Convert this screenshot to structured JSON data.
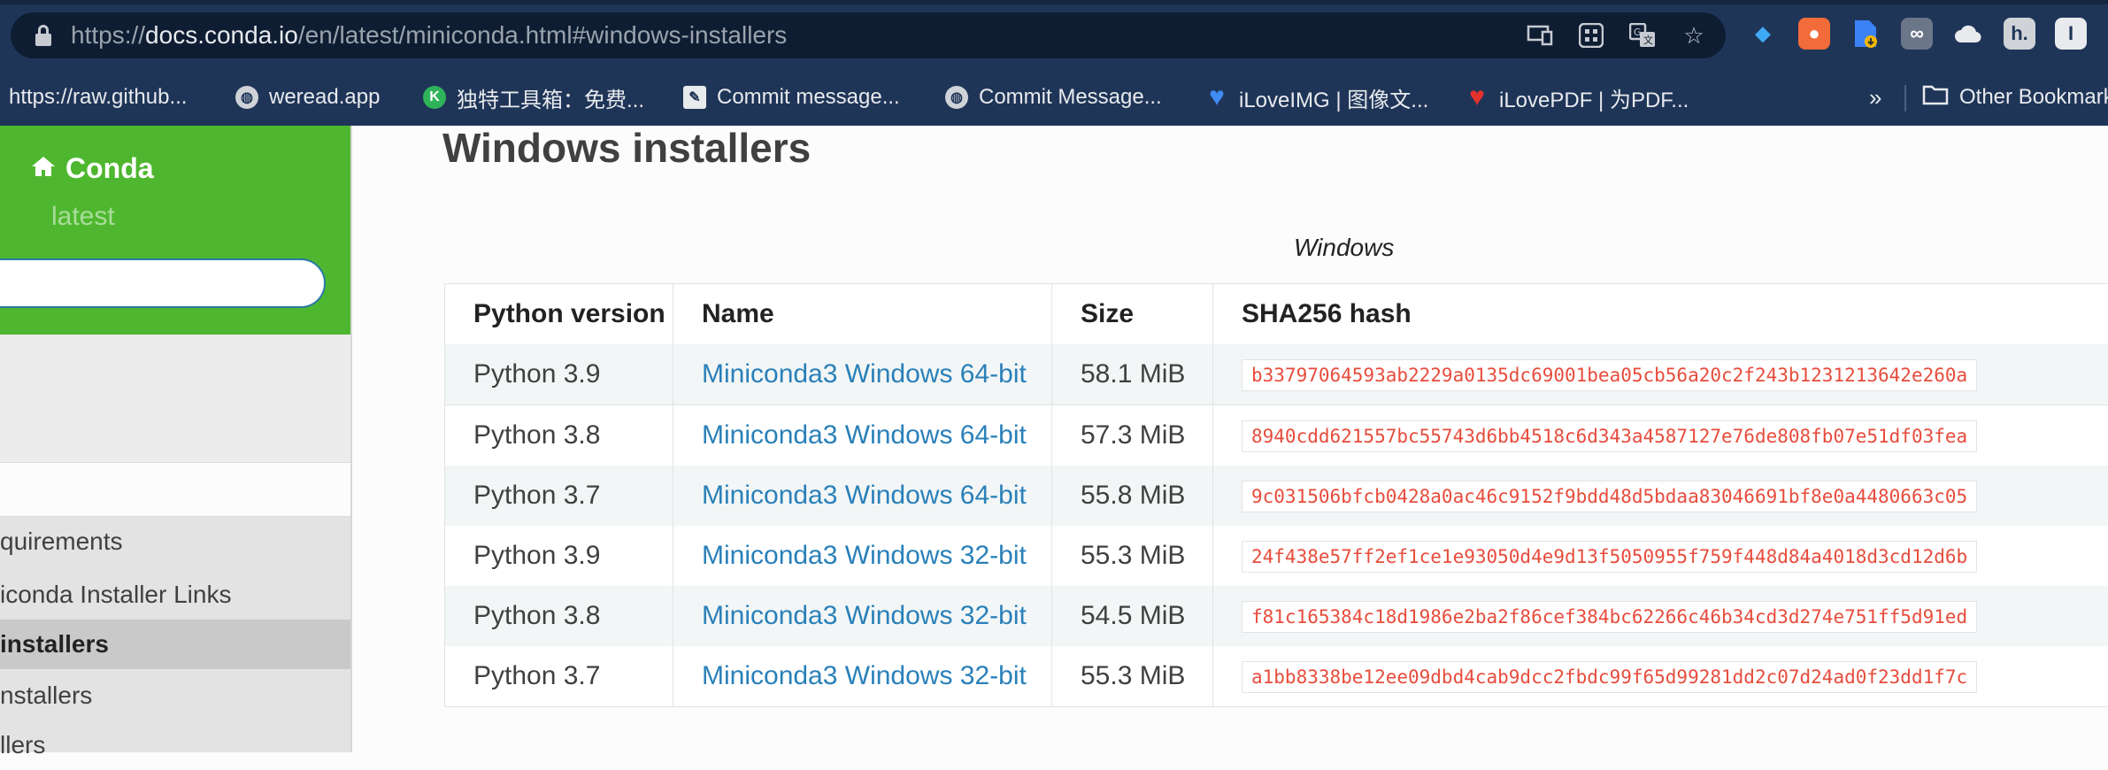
{
  "browser": {
    "url_prefix": "https://",
    "url_domain": "docs.conda.io",
    "url_path": "/en/latest/miniconda.html#windows-installers",
    "bookmarks": [
      {
        "label": "https://raw.github...",
        "icon": "github-raw"
      },
      {
        "label": "weread.app",
        "icon": "globe-icon"
      },
      {
        "label": "独特工具箱：免费...",
        "icon": "toolbox-icon"
      },
      {
        "label": "Commit message...",
        "icon": "commit-icon"
      },
      {
        "label": "Commit Message...",
        "icon": "globe-icon"
      },
      {
        "label": "iLoveIMG | 图像文...",
        "icon": "heart-blue-icon"
      },
      {
        "label": "iLovePDF | 为PDF...",
        "icon": "heart-red-icon"
      }
    ],
    "more_symbol": "»",
    "other_bookmarks": "Other Bookmarks"
  },
  "sidebar": {
    "home_label": "Conda",
    "version": "latest",
    "search_placeholder": "",
    "items": [
      {
        "label": "quirements",
        "active": false
      },
      {
        "label": "iconda Installer Links",
        "active": false
      },
      {
        "label": "installers",
        "active": true
      },
      {
        "label": "nstallers",
        "active": false
      },
      {
        "label": "llers",
        "active": false
      }
    ]
  },
  "main": {
    "heading": "Windows installers",
    "caption": "Windows",
    "columns": [
      "Python version",
      "Name",
      "Size",
      "SHA256 hash"
    ],
    "rows": [
      {
        "python": "Python 3.9",
        "name": "Miniconda3 Windows 64-bit",
        "size": "58.1 MiB",
        "hash": "b33797064593ab2229a0135dc69001bea05cb56a20c2f243b1231213642e260a"
      },
      {
        "python": "Python 3.8",
        "name": "Miniconda3 Windows 64-bit",
        "size": "57.3 MiB",
        "hash": "8940cdd621557bc55743d6bb4518c6d343a4587127e76de808fb07e51df03fea"
      },
      {
        "python": "Python 3.7",
        "name": "Miniconda3 Windows 64-bit",
        "size": "55.8 MiB",
        "hash": "9c031506bfcb0428a0ac46c9152f9bdd48d5bdaa83046691bf8e0a4480663c05"
      },
      {
        "python": "Python 3.9",
        "name": "Miniconda3 Windows 32-bit",
        "size": "55.3 MiB",
        "hash": "24f438e57ff2ef1ce1e93050d4e9d13f5050955f759f448d84a4018d3cd12d6b"
      },
      {
        "python": "Python 3.8",
        "name": "Miniconda3 Windows 32-bit",
        "size": "54.5 MiB",
        "hash": "f81c165384c18d1986e2ba2f86cef384bc62266c46b34cd3d274e751ff5d91ed"
      },
      {
        "python": "Python 3.7",
        "name": "Miniconda3 Windows 32-bit",
        "size": "55.3 MiB",
        "hash": "a1bb8338be12ee09dbd4cab9dcc2fbdc99f65d99281dd2c07d24ad0f23dd1f7c"
      }
    ]
  },
  "colors": {
    "sidebar_green": "#4eb72f",
    "link_blue": "#2980b9",
    "hash_red": "#e74c3c"
  }
}
